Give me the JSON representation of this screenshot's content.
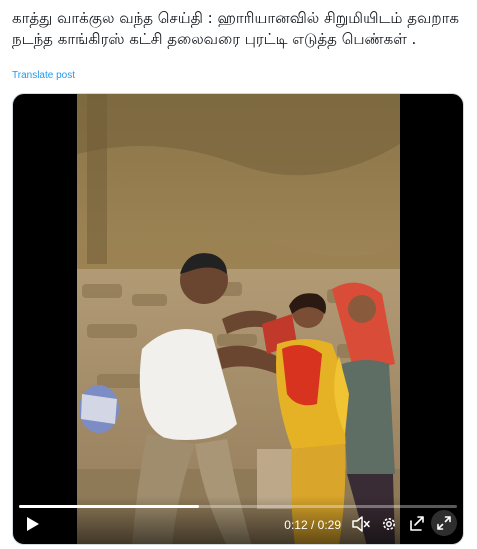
{
  "post": {
    "text": "காத்து வாக்குல வந்த செய்தி : ஹாரியானவில் சிறுமியிடம் தவறாக நடந்த காங்கிரஸ் கட்சி தலைவரை புரட்டி எடுத்த பெண்கள் .",
    "translate_label": "Translate post"
  },
  "video": {
    "current_time": "0:12",
    "separator": " / ",
    "duration": "0:29",
    "progress_fraction": 0.41
  },
  "icons": {
    "play": "play-icon",
    "mute": "volume-mute-icon",
    "settings": "gear-icon",
    "share": "share-icon",
    "fullscreen": "expand-icon"
  },
  "colors": {
    "link": "#1d9bf0",
    "text": "#0f1419",
    "player_bg": "#000000"
  }
}
